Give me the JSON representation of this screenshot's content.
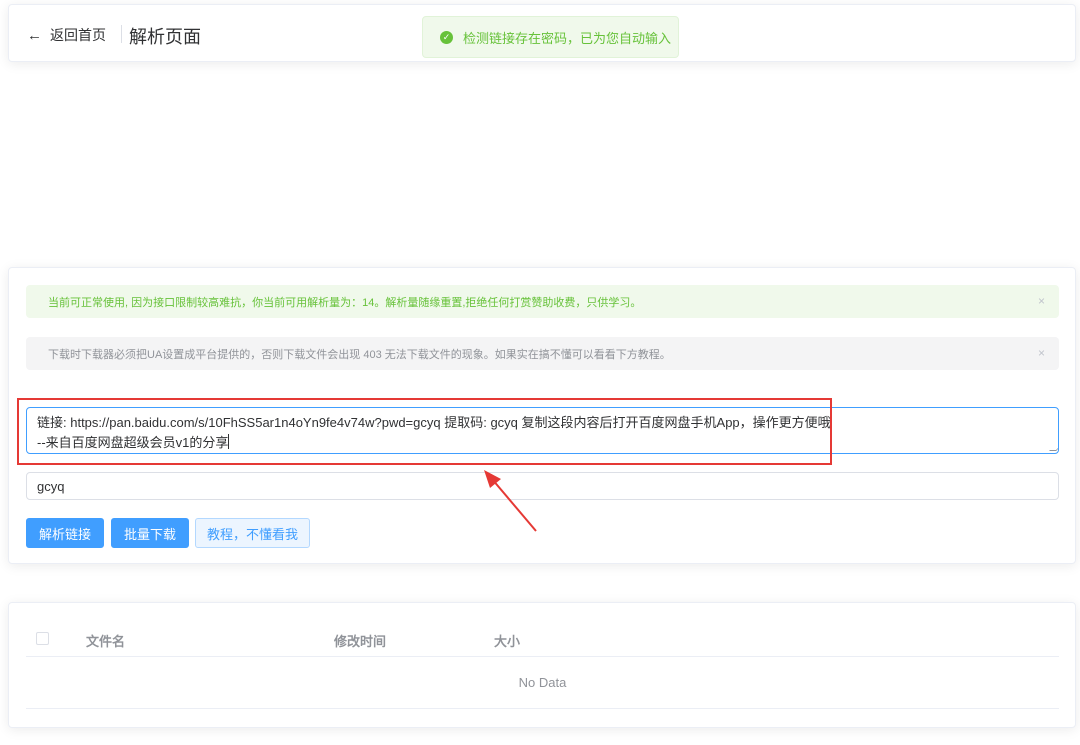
{
  "header": {
    "back_label": "返回首页",
    "page_title": "解析页面",
    "toast_message": "检测链接存在密码，已为您自动输入"
  },
  "alerts": {
    "success_text": "当前可正常使用, 因为接口限制较高难抗，你当前可用解析量为：14。解析量随缘重置,拒绝任何打赏赞助收费，只供学习。",
    "info_text": "下载时下载器必须把UA设置成平台提供的，否则下载文件会出现 403 无法下载文件的现象。如果实在搞不懂可以看看下方教程。",
    "close_glyph": "×"
  },
  "form": {
    "link_value": "链接: https://pan.baidu.com/s/10FhSS5ar1n4oYn9fe4v74w?pwd=gcyq 提取码: gcyq 复制这段内容后打开百度网盘手机App，操作更方便哦\n--来自百度网盘超级会员v1的分享",
    "password_value": "gcyq",
    "parse_button": "解析链接",
    "batch_button": "批量下载",
    "tutorial_button": "教程，不懂看我"
  },
  "table": {
    "columns": [
      "文件名",
      "修改时间",
      "大小"
    ],
    "empty_text": "No Data"
  },
  "colors": {
    "primary": "#409eff",
    "success": "#67c23a",
    "annotation_red": "#e53935"
  },
  "icons": {
    "back": "arrow-left-icon",
    "toast": "check-circle-icon",
    "close": "close-icon"
  }
}
